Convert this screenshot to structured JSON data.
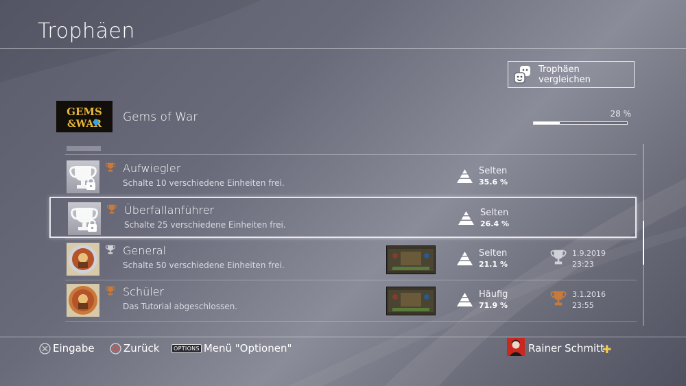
{
  "header": {
    "title": "Trophäen"
  },
  "compare_button": {
    "label": "Trophäen vergleichen",
    "icon": "compare-faces-icon"
  },
  "game": {
    "title": "Gems of War",
    "logo_text": "Gems of War",
    "progress_label": "28 %",
    "progress_value": 0.28
  },
  "trophies": [
    {
      "name": "Aufwiegler",
      "description": "Schalte 10 verschiedene Einheiten frei.",
      "grade": "bronze",
      "locked": true,
      "rarity_label": "Selten",
      "rarity_pct": "35.6 %",
      "screenshot": false,
      "earned": false,
      "date": "",
      "time": ""
    },
    {
      "name": "Überfallanführer",
      "description": "Schalte 25 verschiedene Einheiten frei.",
      "grade": "bronze",
      "locked": true,
      "selected": true,
      "rarity_label": "Selten",
      "rarity_pct": "26.4 %",
      "screenshot": false,
      "earned": false,
      "date": "",
      "time": ""
    },
    {
      "name": "General",
      "description": "Schalte 50 verschiedene Einheiten frei.",
      "grade": "silver",
      "locked": false,
      "rarity_label": "Selten",
      "rarity_pct": "21.1 %",
      "screenshot": true,
      "earned": true,
      "date": "1.9.2019",
      "time": "23:23"
    },
    {
      "name": "Schüler",
      "description": "Das Tutorial abgeschlossen.",
      "grade": "bronze",
      "locked": false,
      "rarity_label": "Häufig",
      "rarity_pct": "71.9 %",
      "screenshot": true,
      "earned": true,
      "date": "3.1.2016",
      "time": "23:55"
    }
  ],
  "footer": {
    "enter_label": "Eingabe",
    "back_label": "Zurück",
    "options_badge": "OPTIONS",
    "options_label": "Menü \"Optionen\"",
    "user_name": "Rainer Schmitt"
  },
  "colors": {
    "bronze": "#c87a3a",
    "silver": "#cfd2d8",
    "accent_plus": "#f2c94c"
  }
}
